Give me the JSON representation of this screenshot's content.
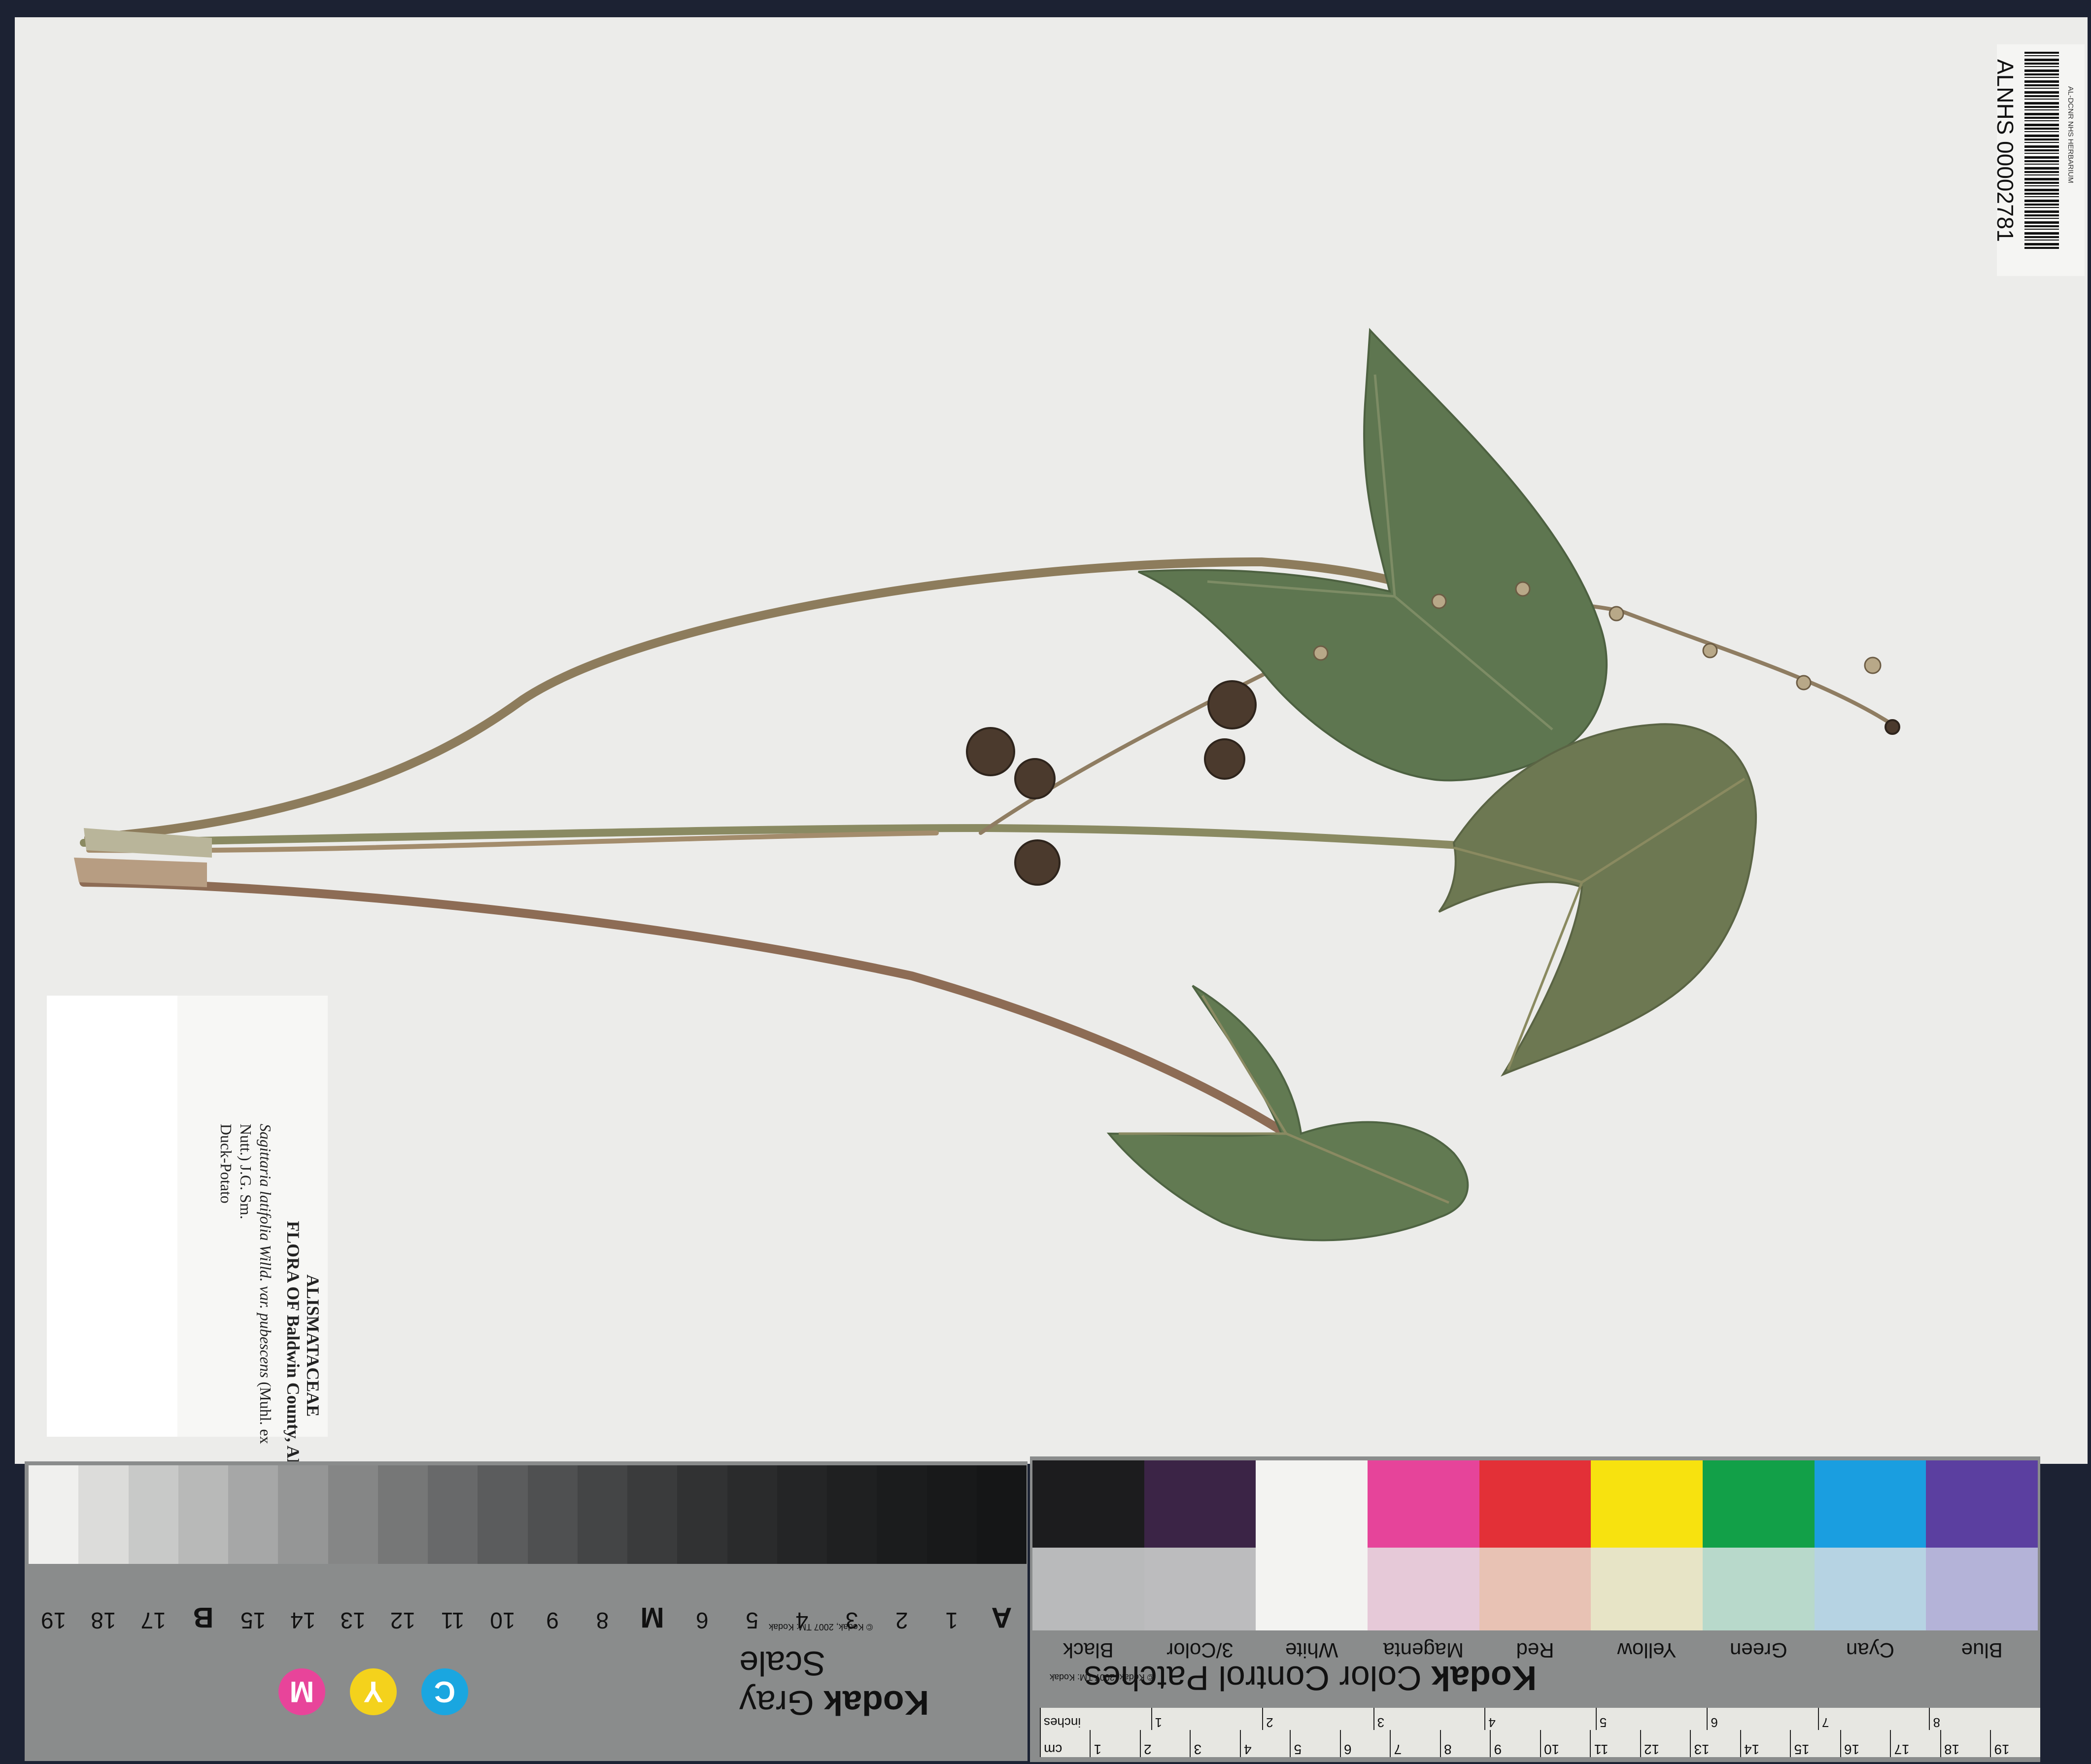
{
  "barcode": {
    "number": "ALNHS 00002781",
    "institution": "AL-DCNR NHS HERBARIUM"
  },
  "label": {
    "family": "ALISMATACEAE",
    "flora": "FLORA OF Baldwin County, AL",
    "scientific_name": "Sagittaria latifolia Willd. var. pubescens",
    "authority_1": "(Muhl. ex",
    "authority_2": "Nutt.) J.G. Sm.",
    "common_name": "Duck-Potato"
  },
  "gray_card": {
    "brand": "Kodak",
    "title": "Gray Scale",
    "copyright": "© Kodak, 2007 TM: Kodak",
    "scale_labels": [
      "A",
      "1",
      "2",
      "3",
      "4",
      "5",
      "6",
      "M",
      "8",
      "9",
      "10",
      "11",
      "12",
      "13",
      "14",
      "15",
      "B",
      "17",
      "18",
      "19"
    ],
    "patch_colors": [
      "#f0f0ee",
      "#dcdcda",
      "#c8c9c8",
      "#b8b9b8",
      "#a6a7a7",
      "#959696",
      "#858686",
      "#767777",
      "#68696a",
      "#5b5c5d",
      "#4f5051",
      "#444546",
      "#3a3b3c",
      "#313233",
      "#2a2b2c",
      "#242526",
      "#1f2021",
      "#1b1c1d",
      "#18191a",
      "#151617"
    ],
    "cmy": [
      "M",
      "Y",
      "C"
    ]
  },
  "color_card": {
    "brand": "Kodak",
    "title": "Color Control Patches",
    "copyright": "© Kodak, 2007 TM: Kodak",
    "patch_names": [
      "Blue",
      "Cyan",
      "Green",
      "Yellow",
      "Red",
      "Magenta",
      "White",
      "3/Color",
      "Black"
    ],
    "top_colors": [
      "#5b3fa0",
      "#1a9ee0",
      "#12a048",
      "#f7e20f",
      "#e33037",
      "#e6449a",
      "#f3f3f1",
      "#3b2446",
      "#1c1c1e"
    ],
    "bottom_colors": [
      "#b4b3d8",
      "#b6d3e3",
      "#b8d9cb",
      "#e7e4c6",
      "#e8c2b4",
      "#e6c9d8",
      "#f3f3f1",
      "#bcbcbe",
      "#b9babb"
    ],
    "ruler_cm": [
      "cm",
      "1",
      "2",
      "3",
      "4",
      "5",
      "6",
      "7",
      "8",
      "9",
      "10",
      "11",
      "12",
      "13",
      "14",
      "15",
      "16",
      "17",
      "18",
      "19"
    ],
    "ruler_in": [
      "inches",
      "1",
      "2",
      "3",
      "4",
      "5",
      "6",
      "7",
      "8"
    ]
  }
}
